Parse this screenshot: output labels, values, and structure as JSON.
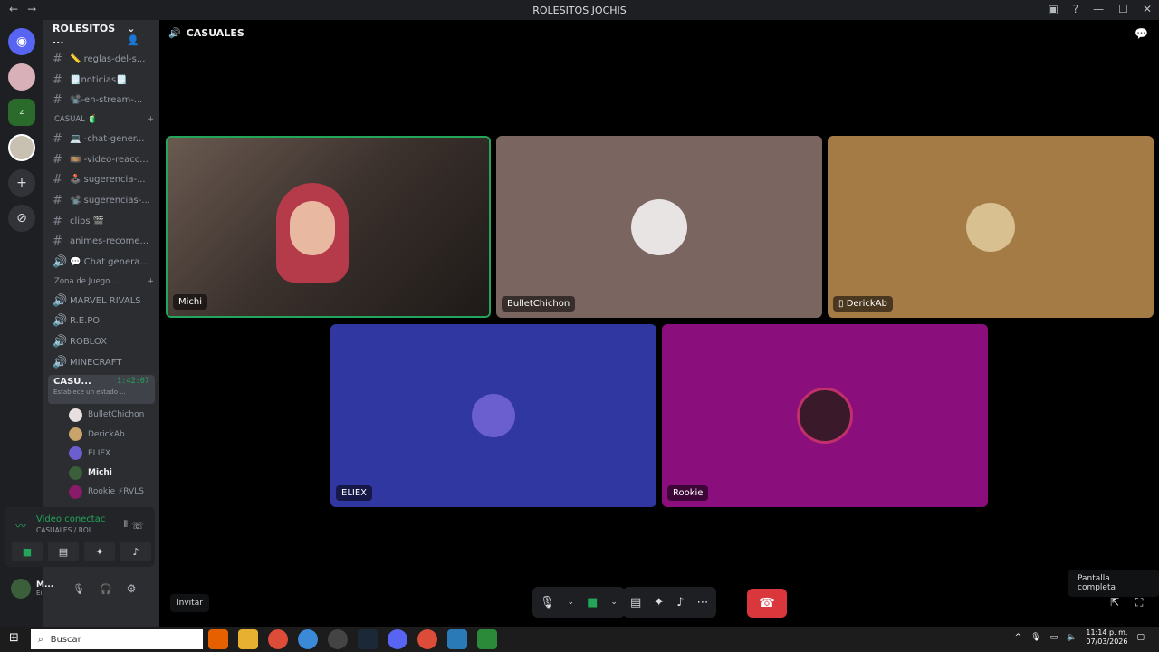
{
  "window": {
    "title": "ROLESITOS JOCHIS"
  },
  "server": {
    "name": "ROLESITOS ..."
  },
  "channels": [
    {
      "icon": "#",
      "label": "📏 reglas-del-s..."
    },
    {
      "icon": "#",
      "label": "🗒️noticias🗒️"
    },
    {
      "icon": "#",
      "label": "📽️-en-stream-..."
    }
  ],
  "categories": {
    "casual": "CASUAL 🧃",
    "games": "Zona de Juego ..."
  },
  "casual_channels": [
    {
      "icon": "#",
      "label": "💻 -chat-gener..."
    },
    {
      "icon": "#",
      "label": "🎞️ -video-reacc..."
    },
    {
      "icon": "#",
      "label": "🕹️ sugerencia-..."
    },
    {
      "icon": "#",
      "label": "📽️ sugerencias-..."
    },
    {
      "icon": "#",
      "label": "clips 🎬"
    },
    {
      "icon": "#",
      "label": "animes-recome..."
    },
    {
      "icon": "🔊",
      "label": "💬 Chat genera..."
    }
  ],
  "game_channels": [
    {
      "icon": "🔊",
      "label": "MARVEL RIVALS"
    },
    {
      "icon": "🔊",
      "label": "R.E.PO"
    },
    {
      "icon": "🔊",
      "label": "ROBLOX"
    },
    {
      "icon": "🔊",
      "label": "MINECRAFT"
    }
  ],
  "active_voice": {
    "label": "CASU...",
    "time": "1:42:07",
    "status": "Establece un estado ..."
  },
  "voice_members": [
    {
      "name": "BulletChichon",
      "color": "#e8e0e0"
    },
    {
      "name": "DerickAb",
      "color": "#c9a46a"
    },
    {
      "name": "ELIEX",
      "color": "#6b5fd0"
    },
    {
      "name": "Michi",
      "color": "#3a5f3a"
    },
    {
      "name": "Rookie ⚡RVLS",
      "color": "#8a1a6a"
    }
  ],
  "voice_panel": {
    "status": "Video conectac",
    "sub": "CASUALES / ROL..."
  },
  "user": {
    "name": "M...",
    "status": "Ei"
  },
  "main": {
    "header": "CASUALES"
  },
  "tiles": [
    {
      "name": "Michi",
      "bg": "#4a3d38"
    },
    {
      "name": "BulletChichon",
      "bg": "#7a6560"
    },
    {
      "name": "DerickAb",
      "bg": "#a57b45"
    },
    {
      "name": "ELIEX",
      "bg": "#3137a0"
    },
    {
      "name": "Rookie",
      "bg": "#8a0e7c"
    }
  ],
  "buttons": {
    "invite": "Invitar",
    "tooltip": "Pantalla completa"
  },
  "taskbar": {
    "search": "Buscar",
    "time": "11:14 p. m.",
    "date": "07/03/2026"
  },
  "colors": {
    "green": "#23a55a",
    "leave": "#da373c",
    "sidebar": "#2b2d31"
  }
}
